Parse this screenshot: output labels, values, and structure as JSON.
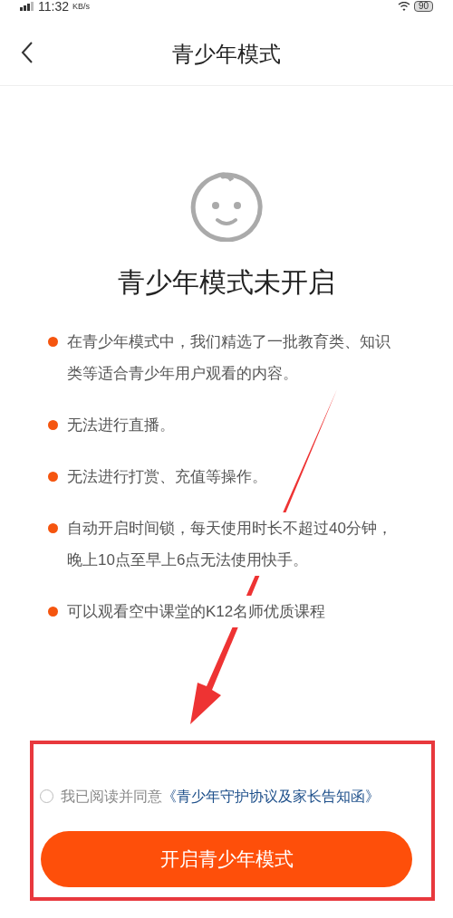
{
  "status_bar": {
    "time": "11:32",
    "speed": "KB/s",
    "battery": "90"
  },
  "header": {
    "title": "青少年模式"
  },
  "status_title": "青少年模式未开启",
  "bullets": [
    "在青少年模式中，我们精选了一批教育类、知识类等适合青少年用户观看的内容。",
    "无法进行直播。",
    "无法进行打赏、充值等操作。",
    "自动开启时间锁，每天使用时长不超过40分钟，晚上10点至早上6点无法使用快手。",
    "可以观看空中课堂的K12名师优质课程"
  ],
  "agreement": {
    "checked": false,
    "text": "我已阅读并同意",
    "link": "《青少年守护协议及家长告知函》"
  },
  "button": "开启青少年模式"
}
